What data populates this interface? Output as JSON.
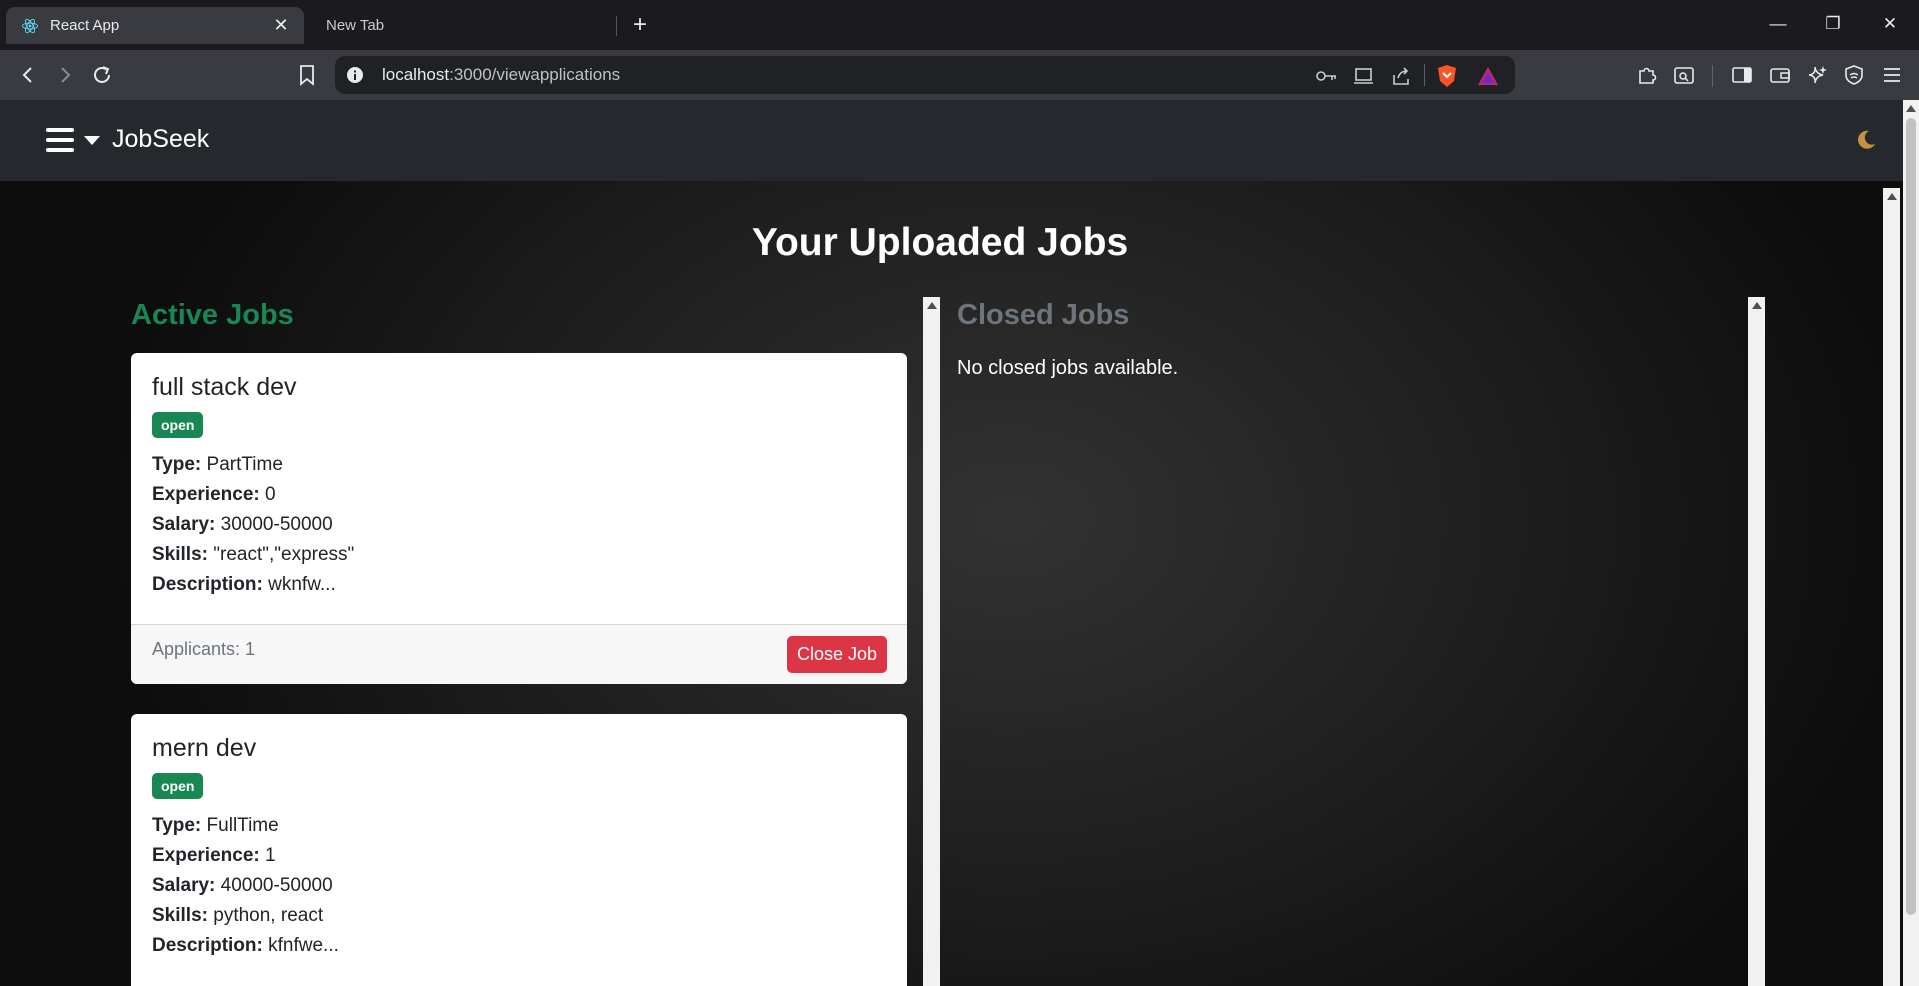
{
  "browser": {
    "tabs": [
      {
        "title": "React App",
        "active": true
      },
      {
        "title": "New Tab",
        "active": false
      }
    ],
    "new_tab_symbol": "+",
    "close_symbol": "✕",
    "window_controls": {
      "minimize": "—",
      "restore": "❐",
      "close": "✕"
    },
    "address": {
      "host": "localhost",
      "rest": ":3000/viewapplications"
    },
    "icons": [
      "back-icon",
      "forward-icon",
      "reload-icon",
      "bookmark-icon",
      "site-info-icon",
      "password-key-icon",
      "install-app-icon",
      "share-icon",
      "brave-shields-icon",
      "brave-rewards-icon",
      "extensions-icon",
      "tab-search-icon",
      "sidebar-icon",
      "wallet-icon",
      "leo-ai-icon",
      "vpn-icon",
      "menu-icon"
    ]
  },
  "navbar": {
    "brand": "JobSeek",
    "theme_icon": "moon-icon"
  },
  "page": {
    "title": "Your Uploaded Jobs",
    "active_heading": "Active Jobs",
    "closed_heading": "Closed Jobs",
    "no_closed_text": "No closed jobs available."
  },
  "labels": {
    "type": "Type:",
    "experience": "Experience:",
    "salary": "Salary:",
    "skills": "Skills:",
    "description": "Description:",
    "close_button": "Close Job"
  },
  "jobs": [
    {
      "title": "full stack dev",
      "status": "open",
      "type": "PartTime",
      "experience": "0",
      "salary": "30000-50000",
      "skills": "\"react\",\"express\"",
      "description": "wknfw...",
      "applicants": "Applicants: 1"
    },
    {
      "title": "mern dev",
      "status": "open",
      "type": "FullTime",
      "experience": "1",
      "salary": "40000-50000",
      "skills": "python, react",
      "description": "kfnfwe..."
    }
  ],
  "colors": {
    "success": "#198754",
    "danger": "#dc3545",
    "secondary": "#6c757d",
    "navbar": "#25282d"
  }
}
